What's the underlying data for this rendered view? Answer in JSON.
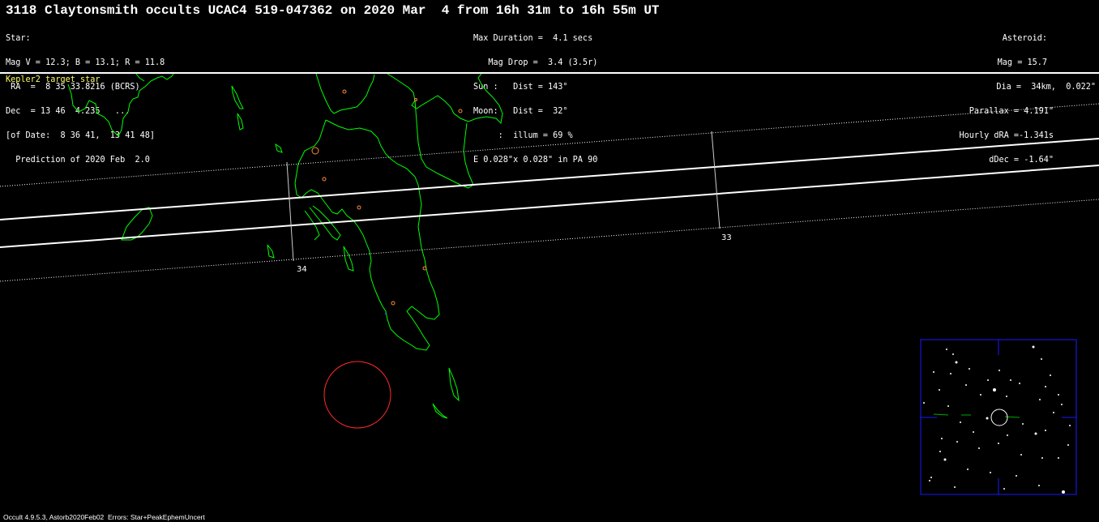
{
  "title": "3118 Claytonsmith occults UCAC4 519-047362 on 2020 Mar  4 from 16h 31m to 16h 55m UT",
  "star_block": [
    "Star:",
    "Mag V = 12.3; B = 13.1; R = 11.8",
    " RA  =  8 35 33.8216 (BCRS)",
    "Dec  = 13 46  4.235   ...",
    "[of Date:  8 36 41,  13 41 48]",
    "  Prediction of 2020 Feb  2.0"
  ],
  "event_block": [
    "Max Duration =  4.1 secs",
    "   Mag Drop =  3.4 (3.5r)",
    "Sun :   Dist = 143°",
    "Moon:   Dist =  32°",
    "     :  illum = 69 %",
    "E 0.028\"x 0.028\" in PA 90"
  ],
  "asteroid_block": [
    "Asteroid:",
    "Mag = 15.7",
    "Dia =  34km,  0.022\"",
    "Parallax = 4.191\"",
    "Hourly dRA =-1.341s",
    "dDec = -1.64\""
  ],
  "kepler_note": "Kepler2 target star",
  "time_labels": [
    "34",
    "33"
  ],
  "footer": "Occult 4.9.5.3, Astorb2020Feb02  Errors: Star+PeakEphemUncert",
  "colors": {
    "background": "#000000",
    "text": "#ffffff",
    "coastline": "#00ff00",
    "path_lines": "#ffffff",
    "uncertainty_lines": "#ffffff",
    "cities": "#ff8c3c",
    "moon_circle": "#ff2a2a",
    "kepler_note": "#ffff66",
    "star_chart_border": "#1a1aff"
  },
  "icons": {
    "city_marker": "small-orange-circle",
    "moon_marker": "red-circle",
    "target_marker": "circle-reticle"
  }
}
